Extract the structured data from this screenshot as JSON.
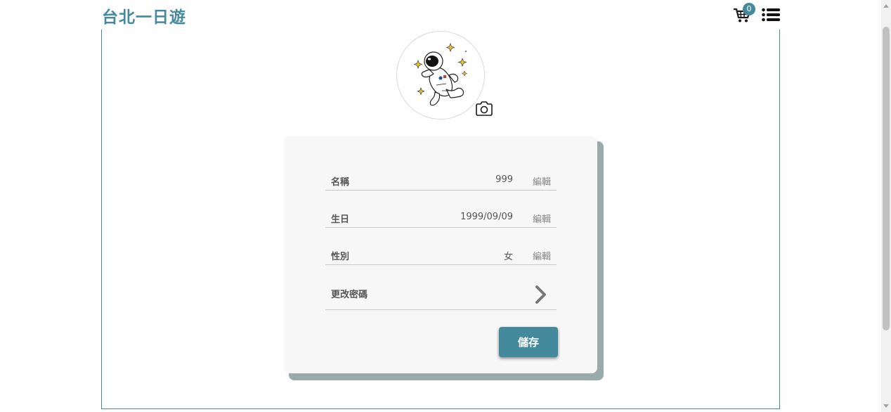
{
  "header": {
    "logo": "台北一日遊",
    "cart_count": "0",
    "cart_icon": "cart-icon",
    "menu_icon": "list-menu-icon"
  },
  "profile": {
    "avatar_icon": "astronaut-illustration",
    "camera_icon": "camera-icon"
  },
  "form": {
    "rows": [
      {
        "label": "名稱",
        "value": "999",
        "edit": "編輯"
      },
      {
        "label": "生日",
        "value": "1999/09/09",
        "edit": "編輯"
      },
      {
        "label": "性別",
        "value": "女",
        "edit": "編輯"
      }
    ],
    "password_label": "更改密碼",
    "save_label": "儲存"
  },
  "colors": {
    "accent": "#458a9c",
    "card_bg": "#f7f7f7",
    "card_shadow": "#9aaaaa"
  }
}
